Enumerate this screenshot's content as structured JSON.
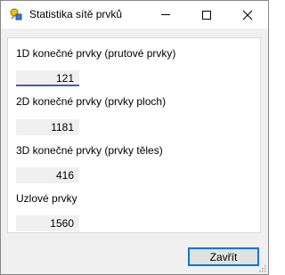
{
  "window": {
    "title": "Statistika sítě prvků"
  },
  "titlebar": {
    "minimize_icon": "minimize-icon",
    "maximize_icon": "maximize-icon",
    "close_icon": "close-icon"
  },
  "stats": [
    {
      "label": "1D konečné prvky (prutové prvky)",
      "value": "121"
    },
    {
      "label": "2D konečné prvky (prvky ploch)",
      "value": "1181"
    },
    {
      "label": "3D konečné prvky (prvky těles)",
      "value": "416"
    },
    {
      "label": "Uzlové prvky",
      "value": "1560"
    }
  ],
  "footer": {
    "close_label": "Zavřít"
  },
  "colors": {
    "accent": "#0078d7",
    "focus_underline": "#4a5aa8"
  }
}
